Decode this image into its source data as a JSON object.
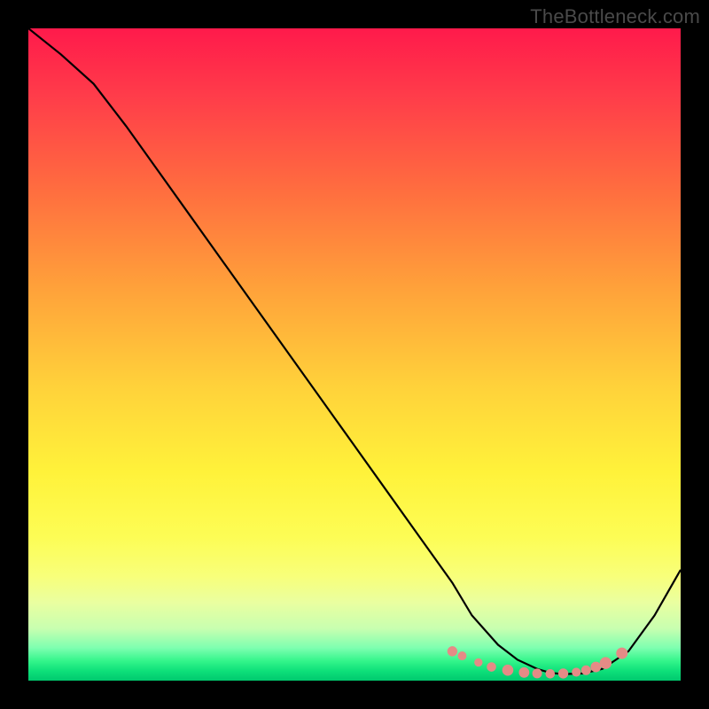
{
  "watermark": "TheBottleneck.com",
  "colors": {
    "curve": "#000000",
    "dot_fill": "#e58b86",
    "dot_stroke": "#e58b86",
    "border": "#000000"
  },
  "chart_data": {
    "type": "line",
    "title": "",
    "xlabel": "",
    "ylabel": "",
    "xlim": [
      0,
      100
    ],
    "ylim": [
      0,
      100
    ],
    "grid": false,
    "series": [
      {
        "name": "bottleneck-curve",
        "x": [
          0,
          5,
          10,
          15,
          20,
          25,
          30,
          35,
          40,
          45,
          50,
          55,
          60,
          65,
          68,
          72,
          75,
          78,
          80,
          82,
          85,
          88,
          92,
          96,
          100
        ],
        "y": [
          100,
          96,
          91.5,
          85,
          78,
          71,
          64,
          57,
          50,
          43,
          36,
          29,
          22,
          15,
          10,
          5.5,
          3.2,
          1.8,
          1.2,
          1.0,
          1.1,
          1.8,
          4.5,
          10,
          17
        ]
      }
    ],
    "highlight_points": {
      "name": "optimal-range-dots",
      "x": [
        65,
        66.5,
        69,
        71,
        73.5,
        76,
        78,
        80,
        82,
        84,
        85.5,
        87,
        88.5,
        91
      ],
      "y": [
        4.5,
        3.8,
        2.8,
        2.1,
        1.6,
        1.25,
        1.1,
        1.05,
        1.1,
        1.3,
        1.6,
        2.1,
        2.7,
        4.2
      ],
      "radii": [
        5.2,
        4.5,
        4.2,
        4.8,
        5.8,
        5.4,
        5.0,
        4.8,
        5.2,
        4.6,
        5.0,
        5.4,
        6.2,
        6.0
      ]
    }
  }
}
